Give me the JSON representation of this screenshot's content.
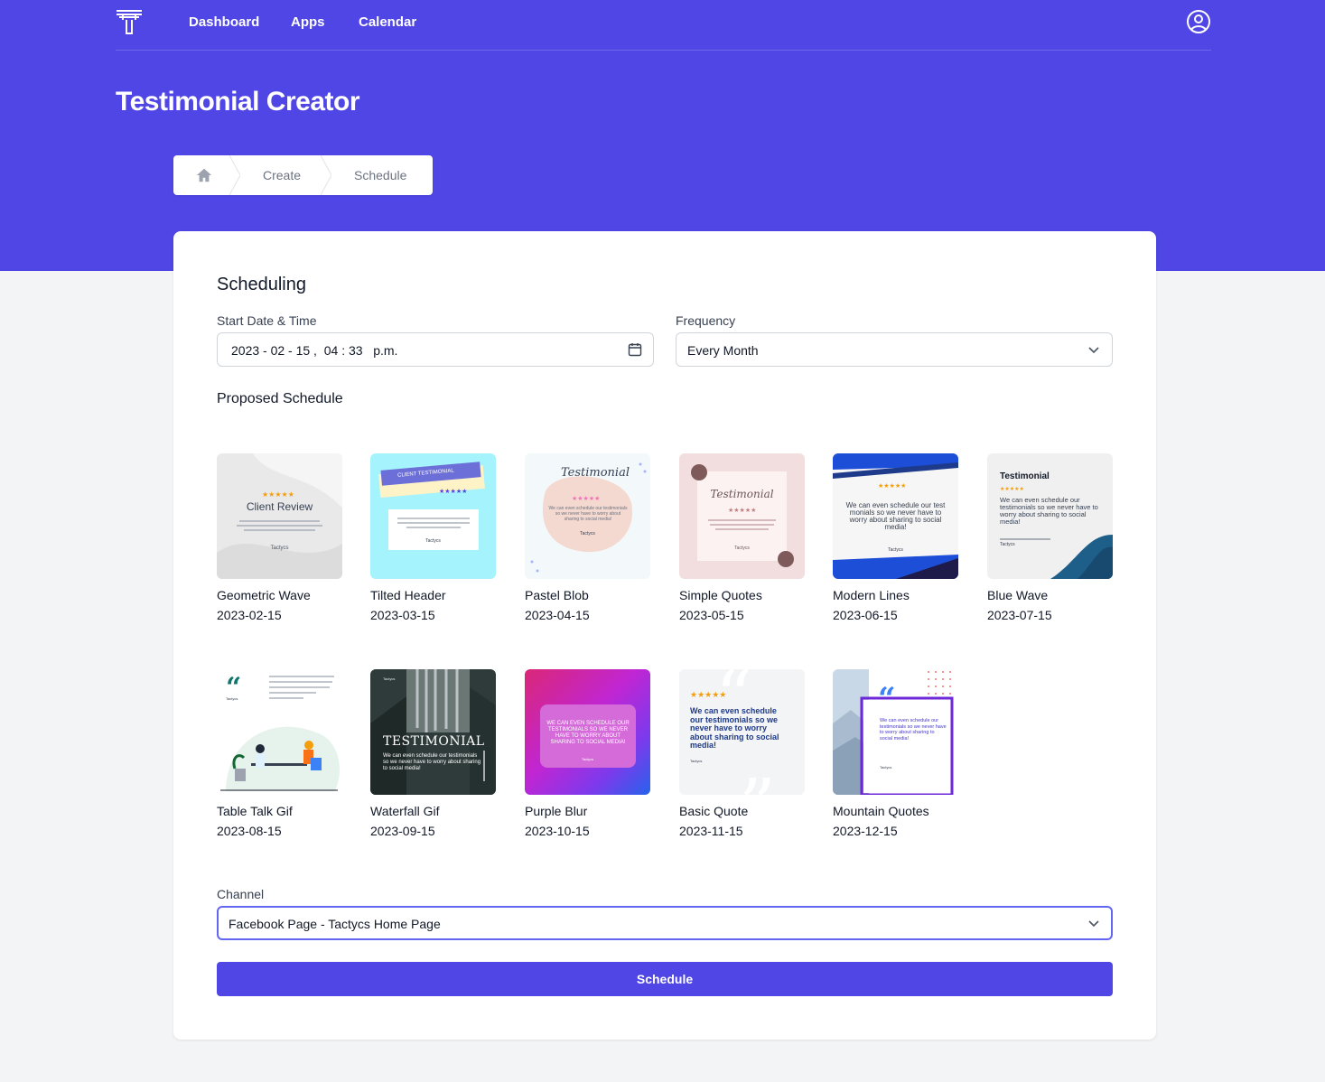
{
  "nav": {
    "links": [
      "Dashboard",
      "Apps",
      "Calendar"
    ]
  },
  "page": {
    "title": "Testimonial Creator"
  },
  "breadcrumb": {
    "items": [
      "Create",
      "Schedule"
    ]
  },
  "scheduling": {
    "title": "Scheduling",
    "start_label": "Start Date & Time",
    "start_value": "2023 - 02 - 15 ,  04 : 33   p.m.",
    "frequency_label": "Frequency",
    "frequency_value": "Every Month",
    "proposed_title": "Proposed Schedule",
    "channel_label": "Channel",
    "channel_value": "Facebook Page - Tactycs Home Page",
    "schedule_button": "Schedule"
  },
  "templates": [
    {
      "name": "Geometric Wave",
      "date": "2023-02-15",
      "thumb": {
        "headline": "Client Review",
        "brand": "Tactycs"
      }
    },
    {
      "name": "Tilted Header",
      "date": "2023-03-15",
      "thumb": {
        "headline": "CLIENT TESTIMONIAL",
        "brand": "Tactycs"
      }
    },
    {
      "name": "Pastel Blob",
      "date": "2023-04-15",
      "thumb": {
        "headline": "Testimonial",
        "body": "We can even schedule our testimonials so we never have to worry about sharing to social media!",
        "brand": "Tactycs"
      }
    },
    {
      "name": "Simple Quotes",
      "date": "2023-05-15",
      "thumb": {
        "headline": "Testimonial",
        "brand": "Tactycs"
      }
    },
    {
      "name": "Modern Lines",
      "date": "2023-06-15",
      "thumb": {
        "body": "We can even schedule our test monials so we never have to worry about sharing to social media!",
        "brand": "Tactycs"
      }
    },
    {
      "name": "Blue Wave",
      "date": "2023-07-15",
      "thumb": {
        "headline": "Testimonial",
        "body": "We can even schedule our testimonials so we never have to worry about sharing to social media!",
        "brand": "Tactycs"
      }
    },
    {
      "name": "Table Talk Gif",
      "date": "2023-08-15",
      "thumb": {
        "brand": "Tactycs"
      }
    },
    {
      "name": "Waterfall Gif",
      "date": "2023-09-15",
      "thumb": {
        "headline": "TESTIMONIAL",
        "body": "We can even schedule our testimonials so we never have to worry about sharing to social media!",
        "brand": "Tactycs"
      }
    },
    {
      "name": "Purple Blur",
      "date": "2023-10-15",
      "thumb": {
        "body": "WE CAN EVEN SCHEDULE OUR TESTIMONIALS SO WE NEVER HAVE TO WORRY ABOUT SHARING TO SOCIAL MEDIA!",
        "brand": "Tactycs"
      }
    },
    {
      "name": "Basic Quote",
      "date": "2023-11-15",
      "thumb": {
        "body": "We can even schedule our testimonials so we never have to worry about sharing to social media!",
        "brand": "Tactycs"
      }
    },
    {
      "name": "Mountain Quotes",
      "date": "2023-12-15",
      "thumb": {
        "body": "We can even schedule our testimonials so we never have to worry about sharing to social media!",
        "brand": "Tactycs"
      }
    }
  ],
  "colors": {
    "brand": "#4f46e5",
    "background": "#f3f4f6",
    "focus": "#6366f1",
    "star": "#f59e0b"
  },
  "icons": {
    "logo": "tactycs-logo",
    "profile": "user-circle-icon",
    "home": "home-icon",
    "calendar": "calendar-icon",
    "chevron": "chevron-down-icon"
  }
}
